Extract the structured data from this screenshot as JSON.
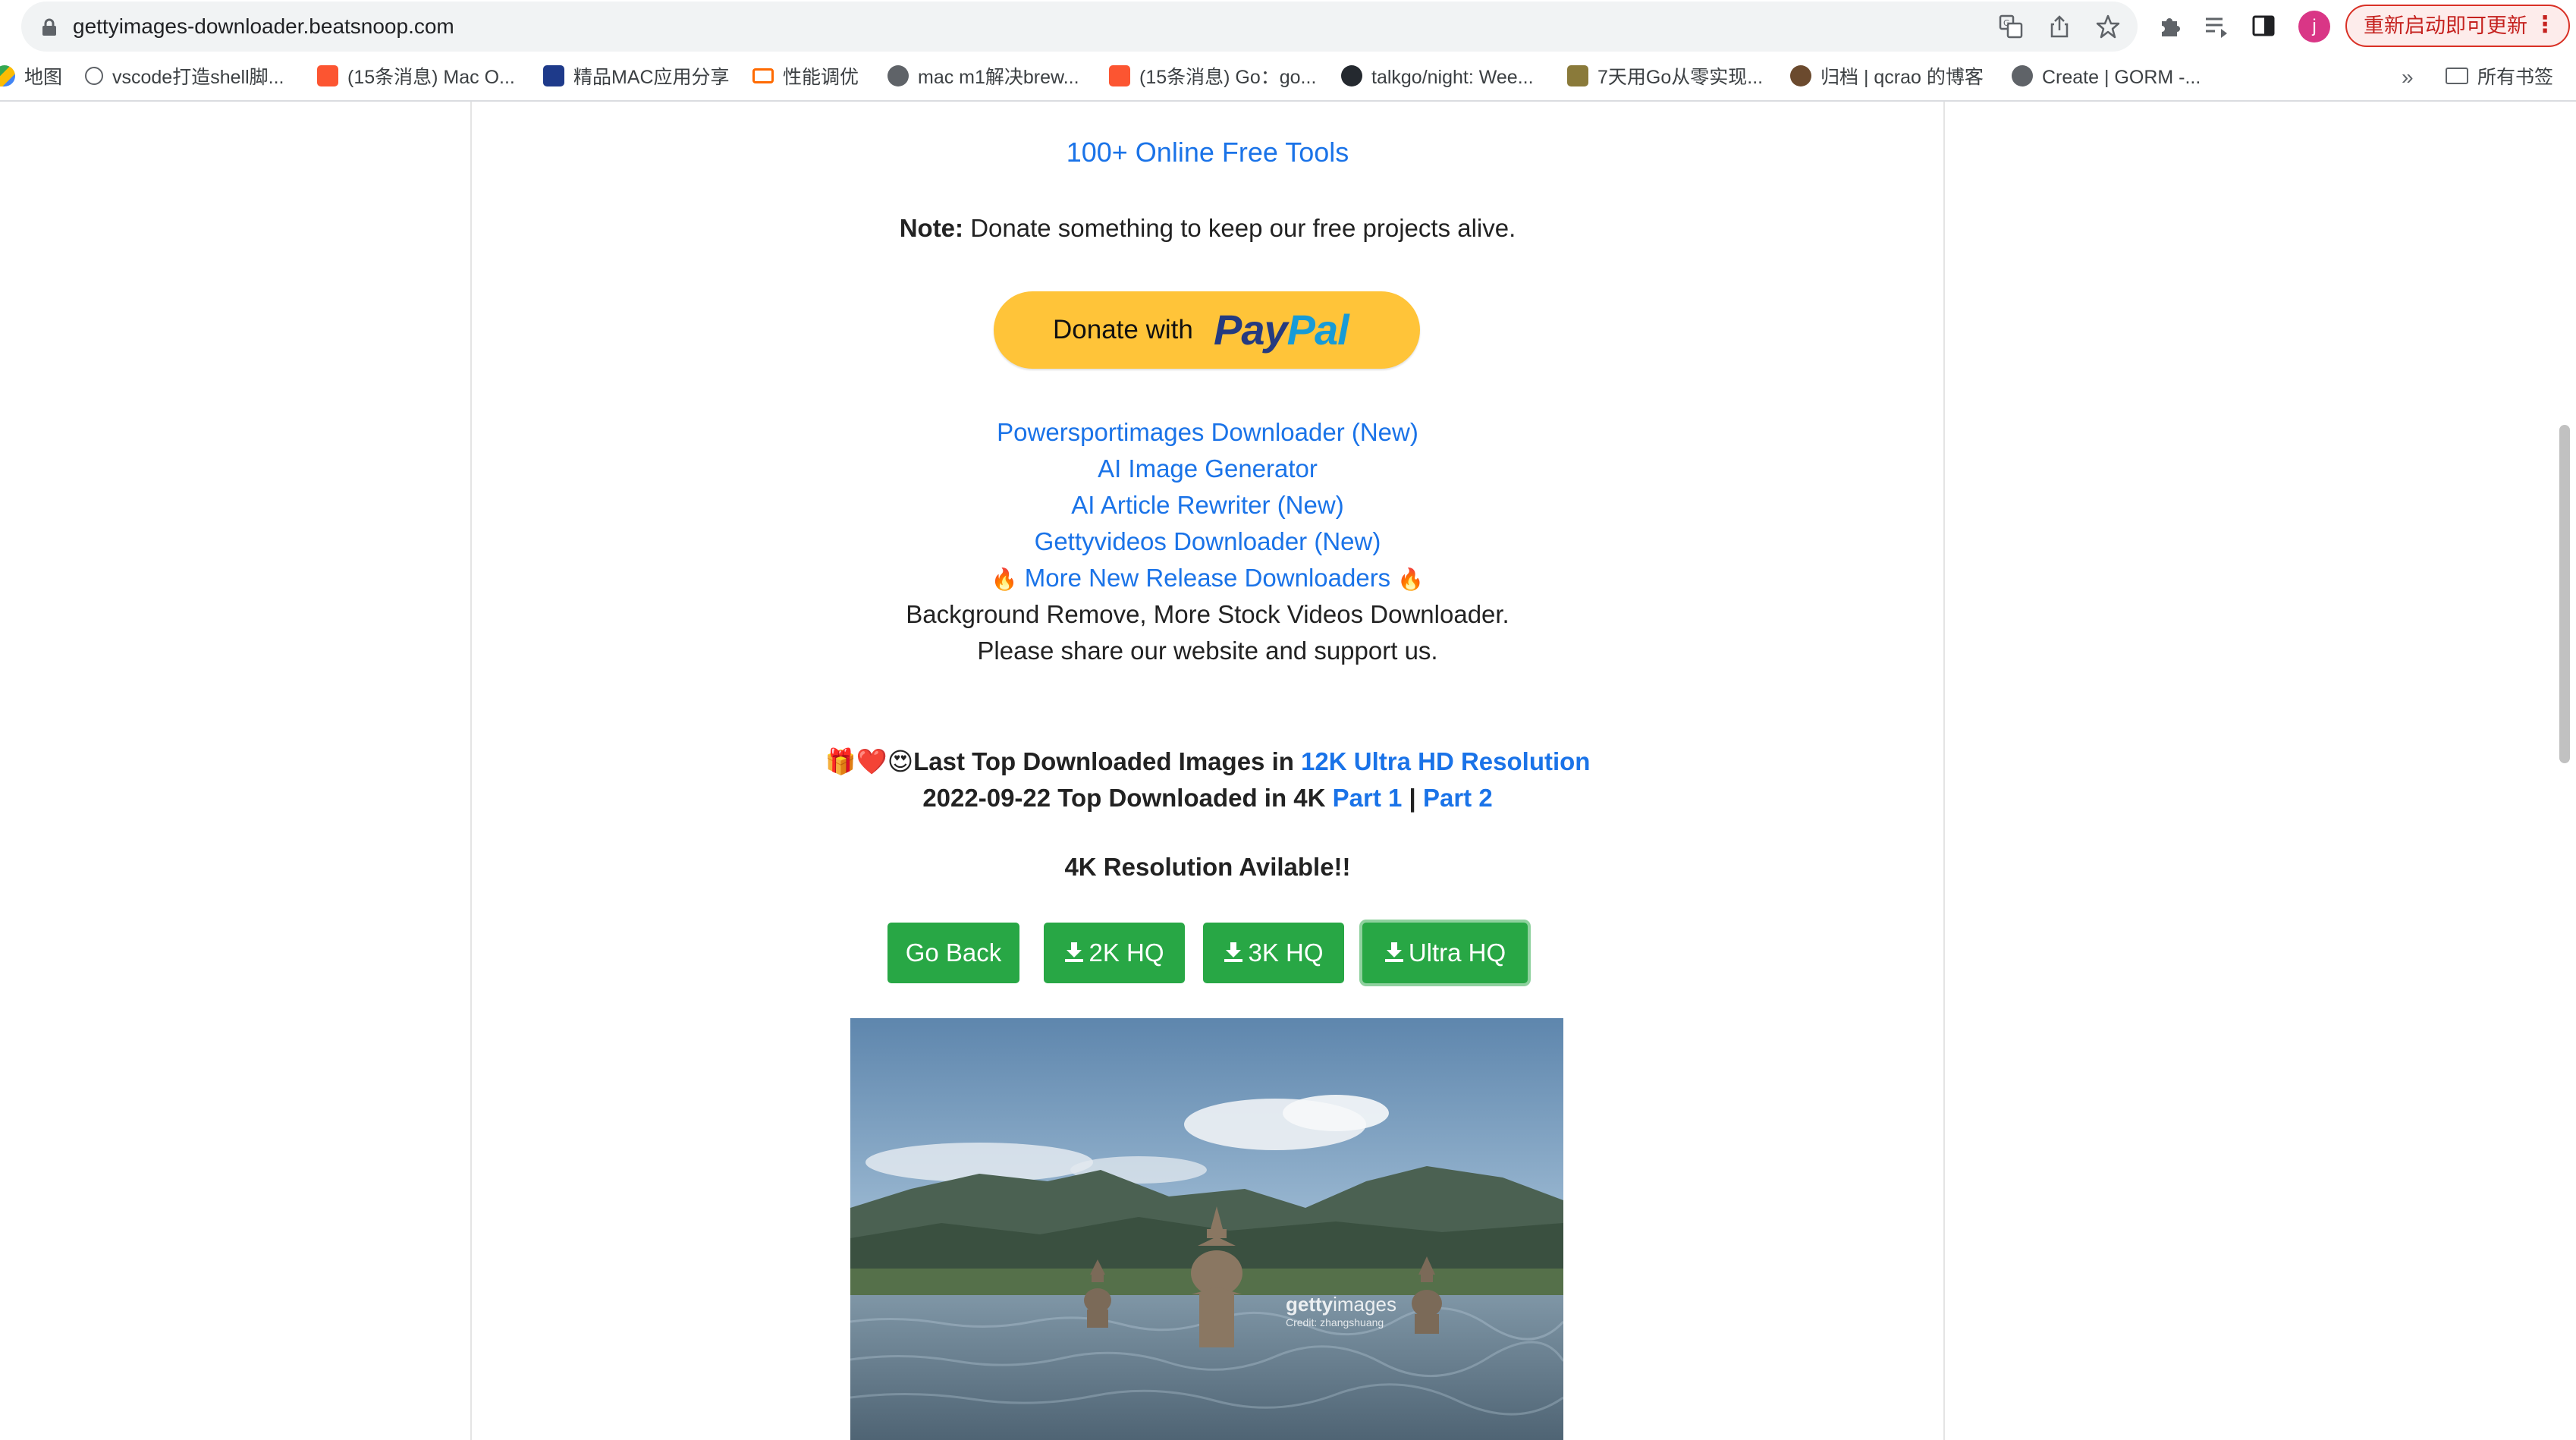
{
  "browser": {
    "url": "gettyimages-downloader.beatsnoop.com",
    "avatar_letter": "j",
    "update_button": "重新启动即可更新",
    "update_menu": "⋮",
    "bookmarks": [
      {
        "label": "地图",
        "icon": "maps-icon"
      },
      {
        "label": "vscode打造shell脚...",
        "icon": "page-icon"
      },
      {
        "label": "(15条消息) Mac O...",
        "icon": "csdn-icon"
      },
      {
        "label": "精品MAC应用分享",
        "icon": "app-icon"
      },
      {
        "label": "性能调优",
        "icon": "aliyun-icon"
      },
      {
        "label": "mac m1解决brew...",
        "icon": "globe-icon"
      },
      {
        "label": "(15条消息) Go：go...",
        "icon": "csdn-icon"
      },
      {
        "label": "talkgo/night: Wee...",
        "icon": "github-icon"
      },
      {
        "label": "7天用Go从零实现...",
        "icon": "image-icon"
      },
      {
        "label": "归档 | qcrao 的博客",
        "icon": "avatar-icon"
      },
      {
        "label": "Create | GORM -...",
        "icon": "globe-icon"
      }
    ],
    "bookmarks_more": "»",
    "all_bookmarks": "所有书签"
  },
  "page": {
    "tools_link": "100+ Online Free Tools",
    "note_label": "Note:",
    "note_text": " Donate something to keep our free projects alive.",
    "paypal": {
      "prefix": "Donate with",
      "logo_part1": "Pay",
      "logo_part2": "Pal"
    },
    "links": [
      "Powersportimages Downloader (New)",
      "AI Image Generator",
      "AI Article Rewriter (New)",
      "Gettyvideos Downloader (New)"
    ],
    "fire_emoji": "🔥",
    "more_link": "More New Release Downloaders",
    "line_bg_remove": "Background Remove, More Stock Videos Downloader.",
    "line_share": "Please share our website and support us.",
    "top_downloaded": {
      "emojis": "🎁❤️😍",
      "text": "Last Top Downloaded Images in ",
      "resolution_link": "12K Ultra HD Resolution",
      "date_text": "2022-09-22 Top Downloaded in 4K ",
      "part1": "Part 1",
      "separator": " | ",
      "part2": "Part 2"
    },
    "available": "4K Resolution Avilable!!",
    "buttons": {
      "go_back": "Go Back",
      "hq2k": "2K HQ",
      "hq3k": "3K HQ",
      "ultra": "Ultra HQ"
    },
    "watermark": {
      "brand_bold": "getty",
      "brand_light": "images",
      "credit": "Credit: zhangshuang"
    }
  },
  "colors": {
    "link": "#1a73e8",
    "button_green": "#28a745",
    "paypal_yellow": "#ffc439"
  }
}
